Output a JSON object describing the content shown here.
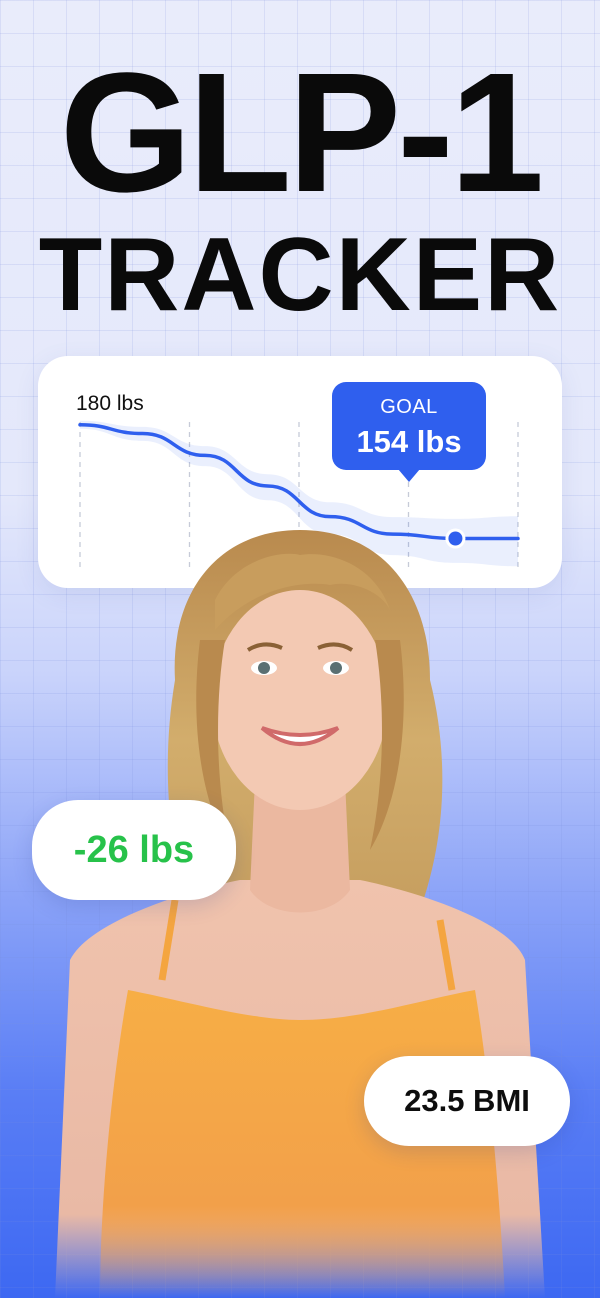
{
  "header": {
    "line1": "GLP-1",
    "line2": "TRACKER"
  },
  "chart_data": {
    "type": "line",
    "start_label": "180 lbs",
    "goal_label": "GOAL",
    "goal_value": "154 lbs",
    "series": [
      {
        "values": [
          180,
          178,
          173,
          166,
          159,
          155,
          154,
          154
        ]
      }
    ],
    "x": [
      0,
      1,
      2,
      3,
      4,
      5,
      6,
      7
    ],
    "ylim": [
      150,
      182
    ],
    "goal_point_index": 6,
    "grid": "vertical dashed",
    "line_color": "#2f5fee"
  },
  "stats": {
    "weight_change": "-26 lbs",
    "bmi": "23.5 BMI"
  },
  "colors": {
    "accent": "#2f5fee",
    "loss_green": "#27c24a",
    "shirt": "#f6a93e",
    "hair": "#c9a261"
  }
}
